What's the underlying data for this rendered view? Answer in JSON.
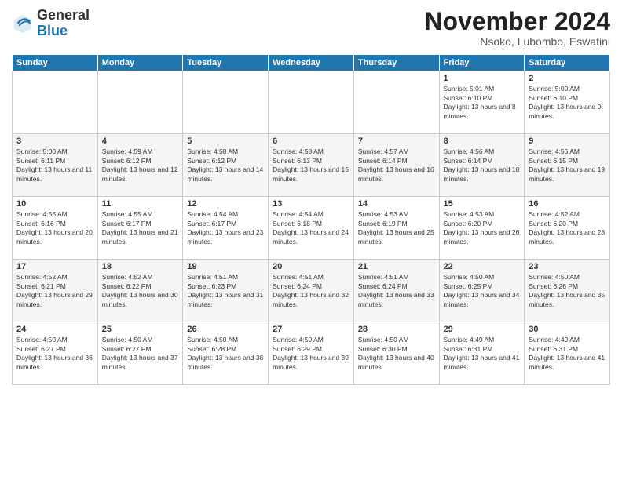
{
  "header": {
    "logo_general": "General",
    "logo_blue": "Blue",
    "month": "November 2024",
    "location": "Nsoko, Lubombo, Eswatini"
  },
  "days_of_week": [
    "Sunday",
    "Monday",
    "Tuesday",
    "Wednesday",
    "Thursday",
    "Friday",
    "Saturday"
  ],
  "weeks": [
    [
      {
        "day": "",
        "text": ""
      },
      {
        "day": "",
        "text": ""
      },
      {
        "day": "",
        "text": ""
      },
      {
        "day": "",
        "text": ""
      },
      {
        "day": "",
        "text": ""
      },
      {
        "day": "1",
        "text": "Sunrise: 5:01 AM\nSunset: 6:10 PM\nDaylight: 13 hours and 8 minutes."
      },
      {
        "day": "2",
        "text": "Sunrise: 5:00 AM\nSunset: 6:10 PM\nDaylight: 13 hours and 9 minutes."
      }
    ],
    [
      {
        "day": "3",
        "text": "Sunrise: 5:00 AM\nSunset: 6:11 PM\nDaylight: 13 hours and 11 minutes."
      },
      {
        "day": "4",
        "text": "Sunrise: 4:59 AM\nSunset: 6:12 PM\nDaylight: 13 hours and 12 minutes."
      },
      {
        "day": "5",
        "text": "Sunrise: 4:58 AM\nSunset: 6:12 PM\nDaylight: 13 hours and 14 minutes."
      },
      {
        "day": "6",
        "text": "Sunrise: 4:58 AM\nSunset: 6:13 PM\nDaylight: 13 hours and 15 minutes."
      },
      {
        "day": "7",
        "text": "Sunrise: 4:57 AM\nSunset: 6:14 PM\nDaylight: 13 hours and 16 minutes."
      },
      {
        "day": "8",
        "text": "Sunrise: 4:56 AM\nSunset: 6:14 PM\nDaylight: 13 hours and 18 minutes."
      },
      {
        "day": "9",
        "text": "Sunrise: 4:56 AM\nSunset: 6:15 PM\nDaylight: 13 hours and 19 minutes."
      }
    ],
    [
      {
        "day": "10",
        "text": "Sunrise: 4:55 AM\nSunset: 6:16 PM\nDaylight: 13 hours and 20 minutes."
      },
      {
        "day": "11",
        "text": "Sunrise: 4:55 AM\nSunset: 6:17 PM\nDaylight: 13 hours and 21 minutes."
      },
      {
        "day": "12",
        "text": "Sunrise: 4:54 AM\nSunset: 6:17 PM\nDaylight: 13 hours and 23 minutes."
      },
      {
        "day": "13",
        "text": "Sunrise: 4:54 AM\nSunset: 6:18 PM\nDaylight: 13 hours and 24 minutes."
      },
      {
        "day": "14",
        "text": "Sunrise: 4:53 AM\nSunset: 6:19 PM\nDaylight: 13 hours and 25 minutes."
      },
      {
        "day": "15",
        "text": "Sunrise: 4:53 AM\nSunset: 6:20 PM\nDaylight: 13 hours and 26 minutes."
      },
      {
        "day": "16",
        "text": "Sunrise: 4:52 AM\nSunset: 6:20 PM\nDaylight: 13 hours and 28 minutes."
      }
    ],
    [
      {
        "day": "17",
        "text": "Sunrise: 4:52 AM\nSunset: 6:21 PM\nDaylight: 13 hours and 29 minutes."
      },
      {
        "day": "18",
        "text": "Sunrise: 4:52 AM\nSunset: 6:22 PM\nDaylight: 13 hours and 30 minutes."
      },
      {
        "day": "19",
        "text": "Sunrise: 4:51 AM\nSunset: 6:23 PM\nDaylight: 13 hours and 31 minutes."
      },
      {
        "day": "20",
        "text": "Sunrise: 4:51 AM\nSunset: 6:24 PM\nDaylight: 13 hours and 32 minutes."
      },
      {
        "day": "21",
        "text": "Sunrise: 4:51 AM\nSunset: 6:24 PM\nDaylight: 13 hours and 33 minutes."
      },
      {
        "day": "22",
        "text": "Sunrise: 4:50 AM\nSunset: 6:25 PM\nDaylight: 13 hours and 34 minutes."
      },
      {
        "day": "23",
        "text": "Sunrise: 4:50 AM\nSunset: 6:26 PM\nDaylight: 13 hours and 35 minutes."
      }
    ],
    [
      {
        "day": "24",
        "text": "Sunrise: 4:50 AM\nSunset: 6:27 PM\nDaylight: 13 hours and 36 minutes."
      },
      {
        "day": "25",
        "text": "Sunrise: 4:50 AM\nSunset: 6:27 PM\nDaylight: 13 hours and 37 minutes."
      },
      {
        "day": "26",
        "text": "Sunrise: 4:50 AM\nSunset: 6:28 PM\nDaylight: 13 hours and 38 minutes."
      },
      {
        "day": "27",
        "text": "Sunrise: 4:50 AM\nSunset: 6:29 PM\nDaylight: 13 hours and 39 minutes."
      },
      {
        "day": "28",
        "text": "Sunrise: 4:50 AM\nSunset: 6:30 PM\nDaylight: 13 hours and 40 minutes."
      },
      {
        "day": "29",
        "text": "Sunrise: 4:49 AM\nSunset: 6:31 PM\nDaylight: 13 hours and 41 minutes."
      },
      {
        "day": "30",
        "text": "Sunrise: 4:49 AM\nSunset: 6:31 PM\nDaylight: 13 hours and 41 minutes."
      }
    ]
  ]
}
